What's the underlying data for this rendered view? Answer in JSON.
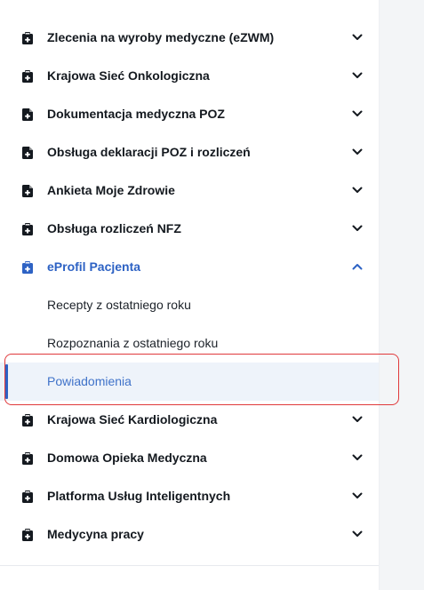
{
  "colors": {
    "text": "#14191f",
    "accent": "#2d62c4",
    "selected_bg": "#eef3fa",
    "highlight_border": "#e0393b"
  },
  "menu": {
    "items": [
      {
        "label": "Zlecenia na wyroby medyczne (eZWM)",
        "icon": "clipboard-icon",
        "expanded": false
      },
      {
        "label": "Krajowa Sieć Onkologiczna",
        "icon": "clipboard-icon",
        "expanded": false
      },
      {
        "label": "Dokumentacja medyczna POZ",
        "icon": "document-icon",
        "expanded": false
      },
      {
        "label": "Obsługa deklaracji POZ i rozliczeń",
        "icon": "document-icon",
        "expanded": false
      },
      {
        "label": "Ankieta Moje Zdrowie",
        "icon": "document-icon",
        "expanded": false
      },
      {
        "label": "Obsługa rozliczeń NFZ",
        "icon": "clipboard-icon",
        "expanded": false
      },
      {
        "label": "eProfil Pacjenta",
        "icon": "clipboard-icon",
        "expanded": true
      },
      {
        "label": "Krajowa Sieć Kardiologiczna",
        "icon": "clipboard-icon",
        "expanded": false
      },
      {
        "label": "Domowa Opieka Medyczna",
        "icon": "clipboard-icon",
        "expanded": false
      },
      {
        "label": "Platforma Usług Inteligentnych",
        "icon": "clipboard-icon",
        "expanded": false
      },
      {
        "label": "Medycyna pracy",
        "icon": "clipboard-icon",
        "expanded": false
      }
    ],
    "eprofil_submenu": [
      {
        "label": "Recepty z ostatniego roku",
        "selected": false
      },
      {
        "label": "Rozpoznania z ostatniego roku",
        "selected": false
      },
      {
        "label": "Powiadomienia",
        "selected": true
      }
    ]
  }
}
